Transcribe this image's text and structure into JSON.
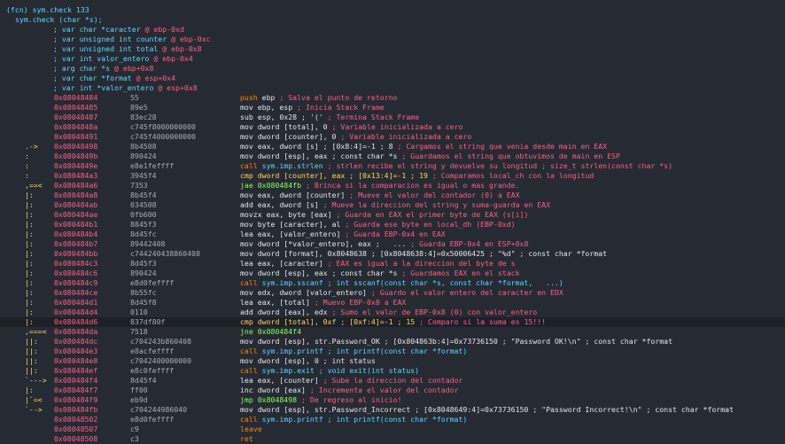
{
  "colors": {
    "background": "#262a33",
    "address": "#ff5f87",
    "comment": "#ff5f87",
    "mnemonic": "#ffd75f",
    "call": "#ff8700",
    "register": "#87afff",
    "flow": "#ffd75f",
    "header": "#5fd7ff"
  },
  "header": {
    "function": "(fcn) sym.check 133",
    "signature": "sym.check (char *s);"
  },
  "vars": [
    {
      "text": "; var char *caracter",
      "loc": "@ ebp-0xd"
    },
    {
      "text": "; var unsigned int counter",
      "loc": "@ ebp-0xc"
    },
    {
      "text": "; var unsigned int total",
      "loc": "@ ebp-0x8"
    },
    {
      "text": "; var int valor_entero",
      "loc": "@ ebp-0x4"
    },
    {
      "text": "; arg char *s",
      "loc": "@ ebp+0x8"
    },
    {
      "text": "; var char *format",
      "loc": "@ esp+0x4"
    },
    {
      "text": "; var int *valor_entero",
      "loc": "@ esp+0x8"
    }
  ],
  "lines": [
    {
      "flow": "",
      "addr": "0x08048484",
      "bytes": "55",
      "mn": "push",
      "ops": "ebp",
      "cm": "; Salva el punto de retorno",
      "k": "push"
    },
    {
      "flow": "",
      "addr": "0x08048485",
      "bytes": "89e5",
      "mn": "mov",
      "ops": "ebp, esp",
      "cm": "; Inicia Stack Frame",
      "k": "mov"
    },
    {
      "flow": "",
      "addr": "0x08048487",
      "bytes": "83ec28",
      "mn": "sub",
      "ops": "esp, 0x28 ; '('",
      "cm": "; Termina Stack Frame",
      "k": "mov"
    },
    {
      "flow": "",
      "addr": "0x0804848a",
      "bytes": "c745f8000000000",
      "mn": "mov",
      "ops": "dword [total], 0",
      "cm": "; Variable inicializada a cero",
      "k": "mov"
    },
    {
      "flow": "",
      "addr": "0x08048491",
      "bytes": "c745f4000000000",
      "mn": "mov",
      "ops": "dword [counter], 0",
      "cm": "; Variable inicializada a cero",
      "k": "mov"
    },
    {
      "flow": ".->",
      "addr": "0x08048498",
      "bytes": "8b4508",
      "mn": "mov",
      "ops": "eax, dword [s] ; [0x8:4]=-1 ; 8",
      "cm": "; Cargamos el string que venia desde main en EAX",
      "k": "mov"
    },
    {
      "flow": ":",
      "addr": "0x0804849b",
      "bytes": "890424",
      "mn": "mov",
      "ops": "dword [esp], eax ; const char *s",
      "cm": "; Guardamos el string que obtuvimos de main en ESP",
      "k": "mov"
    },
    {
      "flow": ":",
      "addr": "0x0804849e",
      "bytes": "e8e1feffff",
      "mn": "call",
      "ops": "sym.imp.strlen",
      "cm": "; strlen recibe el string y devuelve su longitud ; size_t strlen(const char *s)",
      "k": "call"
    },
    {
      "flow": ":",
      "addr": "0x080484a3",
      "bytes": "3945f4",
      "mn": "cmp",
      "ops": "dword [counter], eax ; [0x13:4]=-1 ; 19",
      "cm": "; Comparamos local_ch con la longitud",
      "k": "call"
    },
    {
      "flow": ",==<",
      "addr": "0x080484a6",
      "bytes": "7353",
      "mn": "jae",
      "ops": "0x080484fb",
      "cm": "; Brinca si la comparacion es igual o mas grande.",
      "k": "jmp"
    },
    {
      "flow": "|:",
      "addr": "0x080484a8",
      "bytes": "8b45f4",
      "mn": "mov",
      "ops": "eax, dword [counter]",
      "cm": "; Mueve el valor del contador (0) a EAX",
      "k": "mov"
    },
    {
      "flow": "|:",
      "addr": "0x080484ab",
      "bytes": "034508",
      "mn": "add",
      "ops": "eax, dword [s]",
      "cm": "; Mueve la direccion del string y suma-guarda en EAX",
      "k": "mov"
    },
    {
      "flow": "|:",
      "addr": "0x080484ae",
      "bytes": "0fb600",
      "mn": "movzx",
      "ops": "eax, byte [eax]",
      "cm": "; Guarda en EAX el primer byte de EAX (s[i])",
      "k": "mov"
    },
    {
      "flow": "|:",
      "addr": "0x080484b1",
      "bytes": "8845f3",
      "mn": "mov",
      "ops": "byte [caracter], al",
      "cm": "; Guarda ese byte en local_dh (EBP-0xd)",
      "k": "mov"
    },
    {
      "flow": "|:",
      "addr": "0x080484b4",
      "bytes": "8d45fc",
      "mn": "lea",
      "ops": "eax, [valor_entero]",
      "cm": "; Guarda EBP-0x4 en EAX",
      "k": "mov"
    },
    {
      "flow": "|:",
      "addr": "0x080484b7",
      "bytes": "89442408",
      "mn": "mov",
      "ops": "dword [*valor_entero], eax ;   ...",
      "cm": "; Guarda EBP-0x4 en ESP+0x8",
      "k": "mov"
    },
    {
      "flow": "|:",
      "addr": "0x080484bb",
      "bytes": "c744240438860408",
      "mn": "mov",
      "ops": "dword [format], 0x8048638 ; [0x8048638:4]=0x50006425 ; \"%d\" ; const char *format",
      "cm": "",
      "k": "mov"
    },
    {
      "flow": "|:",
      "addr": "0x080484c3",
      "bytes": "8d45f3",
      "mn": "lea",
      "ops": "eax, [caracter]",
      "cm": "; EAX es igual a la direccion del byte de s",
      "k": "mov"
    },
    {
      "flow": "|:",
      "addr": "0x080484c6",
      "bytes": "890424",
      "mn": "mov",
      "ops": "dword [esp], eax ; const char *s",
      "cm": "; Guardamos EAX en el stack",
      "k": "mov"
    },
    {
      "flow": "|:",
      "addr": "0x080484c9",
      "bytes": "e8d0feffff",
      "mn": "call",
      "ops": "sym.imp.sscanf ; int sscanf(const char *s, const char *format,   ...)",
      "cm": "",
      "k": "call"
    },
    {
      "flow": "|:",
      "addr": "0x080484ce",
      "bytes": "8b55fc",
      "mn": "mov",
      "ops": "edx, dword [valor_entero]",
      "cm": "; Guardo el valor entero del caracter en EDX",
      "k": "mov"
    },
    {
      "flow": "|:",
      "addr": "0x080484d1",
      "bytes": "8d45f8",
      "mn": "lea",
      "ops": "eax, [total]",
      "cm": "; Muevo EBP-0x8 a EAX",
      "k": "mov"
    },
    {
      "flow": "|:",
      "addr": "0x080484d4",
      "bytes": "0110",
      "mn": "add",
      "ops": "dword [eax], edx",
      "cm": "; Sumo el valor de EBP-0x8 (0) con valor_entero",
      "k": "mov"
    },
    {
      "flow": "|:",
      "addr": "0x080484d6",
      "bytes": "837df80f",
      "mn": "cmp",
      "ops": "dword [total], 0xf ; [0xf:4]=-1 ; 15",
      "cm": "; Comparo si la suma es 15!!!",
      "k": "call",
      "hl": true
    },
    {
      "flow": ",===<",
      "addr": "0x080484da",
      "bytes": "7518",
      "mn": "jne",
      "ops": "0x080484f4",
      "cm": "",
      "k": "jmp"
    },
    {
      "flow": "||:",
      "addr": "0x080484dc",
      "bytes": "c704243b860408",
      "mn": "mov",
      "ops": "dword [esp], str.Password_OK ; [0x804863b:4]=0x73736150 ; \"Password OK!\\n\" ; const char *format",
      "cm": "",
      "k": "mov"
    },
    {
      "flow": "||:",
      "addr": "0x080484e3",
      "bytes": "e8acfeffff",
      "mn": "call",
      "ops": "sym.imp.printf ; int printf(const char *format)",
      "cm": "",
      "k": "call"
    },
    {
      "flow": "||:",
      "addr": "0x080484e8",
      "bytes": "c7042400000000",
      "mn": "mov",
      "ops": "dword [esp], 0 ; int status",
      "cm": "",
      "k": "mov"
    },
    {
      "flow": "||:",
      "addr": "0x080484ef",
      "bytes": "e8c0feffff",
      "mn": "call",
      "ops": "sym.imp.exit ; void exit(int status)",
      "cm": "",
      "k": "call"
    },
    {
      "flow": "`--->",
      "addr": "0x080484f4",
      "bytes": "8d45f4",
      "mn": "lea",
      "ops": "eax, [counter]",
      "cm": "; Sube la direccion del contador",
      "k": "mov"
    },
    {
      "flow": "|:",
      "addr": "0x080484f7",
      "bytes": "ff00",
      "mn": "inc",
      "ops": "dword [eax]",
      "cm": "; Incrementa el valor del contador",
      "k": "mov"
    },
    {
      "flow": "|`=<",
      "addr": "0x080484f9",
      "bytes": "eb9d",
      "mn": "jmp",
      "ops": "0x8048498",
      "cm": "; De regreso al inicio!",
      "k": "jmp"
    },
    {
      "flow": "`-->",
      "addr": "0x080484fb",
      "bytes": "c704244986040",
      "mn": "mov",
      "ops": "dword [esp], str.Password_Incorrect ; [0x8048649:4]=0x73736150 ; \"Password Incorrect!\\n\" ; const char *format",
      "cm": "",
      "k": "mov"
    },
    {
      "flow": "",
      "addr": "0x08048502",
      "bytes": "e8d0feffff",
      "mn": "call",
      "ops": "sym.imp.printf ; int printf(const char *format)",
      "cm": "",
      "k": "call"
    },
    {
      "flow": "",
      "addr": "0x08048507",
      "bytes": "c9",
      "mn": "leave",
      "ops": "",
      "cm": "",
      "k": "push"
    },
    {
      "flow": "",
      "addr": "0x08048508",
      "bytes": "c3",
      "mn": "ret",
      "ops": "",
      "cm": "",
      "k": "push"
    }
  ]
}
